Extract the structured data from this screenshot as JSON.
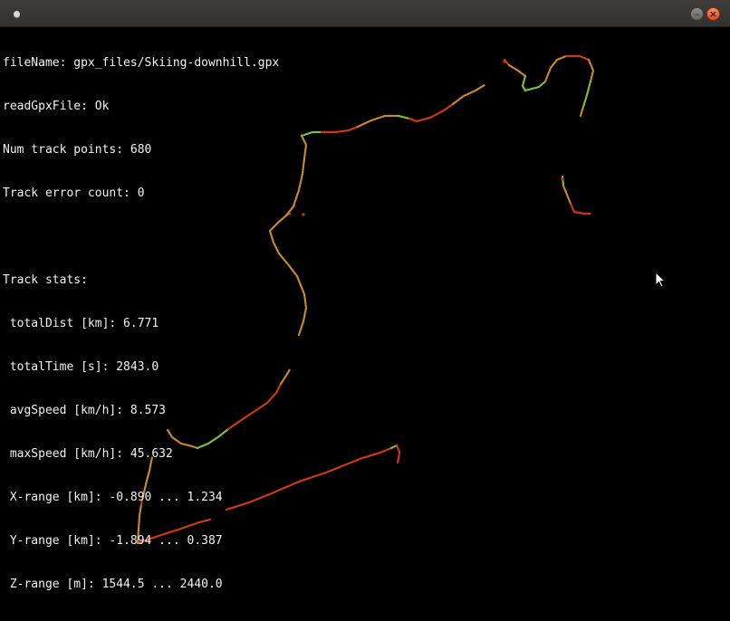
{
  "window": {
    "menu_icon": "circle-menu-icon",
    "minimize_icon": "minimize-icon",
    "close_icon": "close-icon",
    "minimize_glyph": "–",
    "close_glyph": "×",
    "titlebar_color": "#3a3935",
    "close_color": "#e9572a"
  },
  "info": {
    "file_name_line": "fileName: gpx_files/Skiing-downhill.gpx",
    "read_line": "readGpxFile: Ok",
    "points_line": "Num track points: 680",
    "errors_line": "Track error count: 0",
    "stats_header": "Track stats:",
    "total_dist": " totalDist [km]: 6.771",
    "total_time": " totalTime [s]: 2843.0",
    "avg_speed": " avgSpeed [km/h]: 8.573",
    "max_speed": " maxSpeed [km/h]: 45.632",
    "x_range": " X-range [km]: -0.890 ... 1.234",
    "y_range": " Y-range [km]: -1.894 ... 0.387",
    "z_range": " Z-range [m]: 1544.5 ... 2440.0"
  },
  "track": {
    "colors": {
      "slow": "#d2380e",
      "mid": "#c9892a",
      "fast": "#7fbf3f"
    }
  },
  "cursor_icon": "mouse-pointer-icon"
}
